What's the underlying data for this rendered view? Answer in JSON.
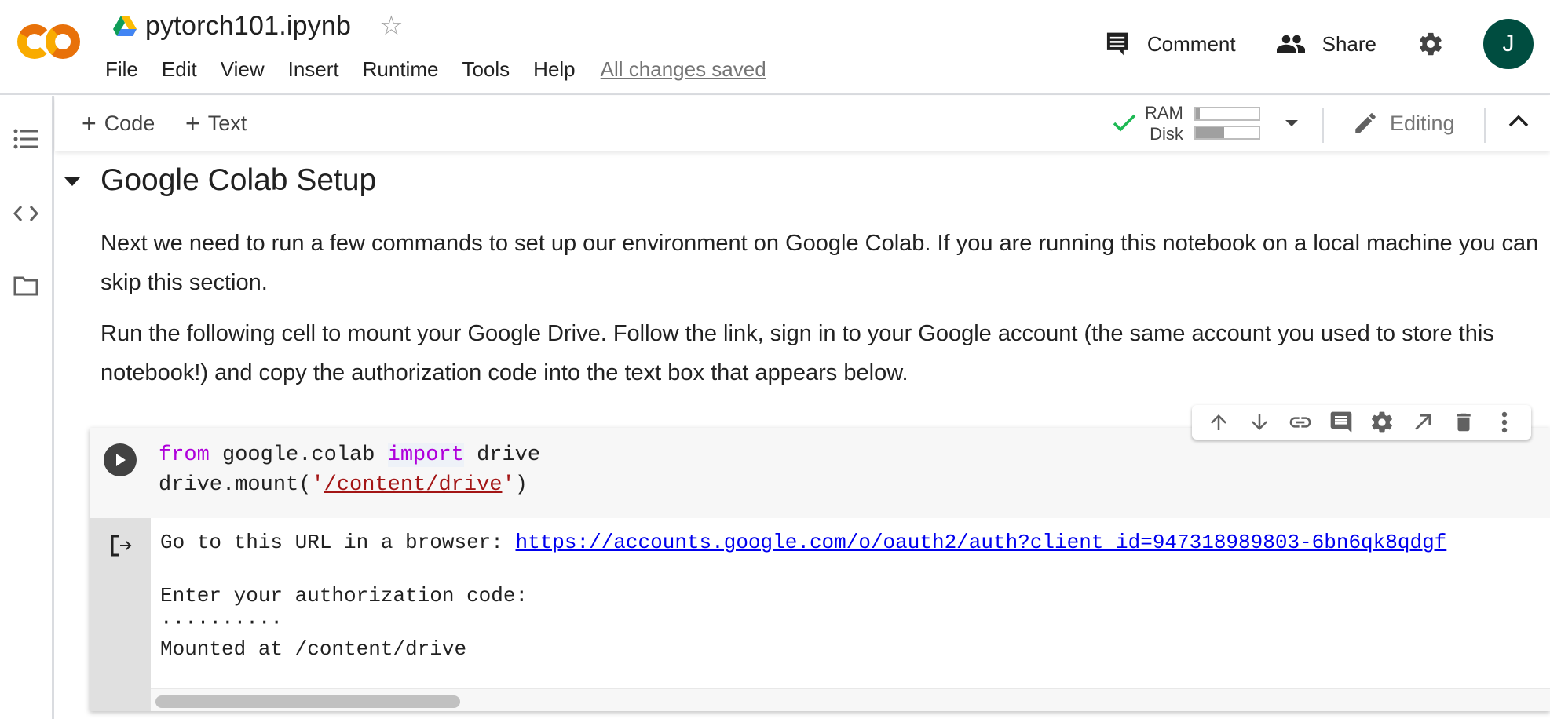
{
  "header": {
    "notebook_title": "pytorch101.ipynb",
    "menu": [
      "File",
      "Edit",
      "View",
      "Insert",
      "Runtime",
      "Tools",
      "Help"
    ],
    "save_status": "All changes saved",
    "comment_label": "Comment",
    "share_label": "Share",
    "avatar_initial": "J",
    "avatar_color": "#004d40",
    "logo_colors": [
      "#f9ab00",
      "#e8710a"
    ]
  },
  "sidebar": {
    "items": [
      {
        "icon": "table-of-contents-icon"
      },
      {
        "icon": "code-snippets-icon"
      },
      {
        "icon": "files-folder-icon"
      }
    ]
  },
  "toolbar": {
    "add_code_label": "Code",
    "add_text_label": "Text",
    "resources": {
      "status": "connected",
      "status_color": "#1db954",
      "ram_label": "RAM",
      "disk_label": "Disk",
      "ram_usage_fraction": 0.06,
      "disk_usage_fraction": 0.45
    },
    "mode_label": "Editing"
  },
  "notebook": {
    "section_heading": "Google Colab Setup",
    "paragraphs": [
      "Next we need to run a few commands to set up our environment on Google Colab. If you are running this notebook on a local machine you can skip this section.",
      "Run the following cell to mount your Google Drive. Follow the link, sign in to your Google account (the same account you used to store this notebook!) and copy the authorization code into the text box that appears below."
    ],
    "cell": {
      "code": {
        "line1": {
          "kw1": "from",
          "mod": " google.colab ",
          "kw2": "import",
          "rest": " drive"
        },
        "line2": {
          "pre": "drive.mount(",
          "q1": "'",
          "path": "/content/drive",
          "q2": "'",
          "post": ")"
        }
      },
      "output": {
        "url_prefix": "Go to this URL in a browser: ",
        "url": "https://accounts.google.com/o/oauth2/auth?client_id=947318989803-6bn6qk8qdgf",
        "prompt": "Enter your authorization code:",
        "masked_input": "··········",
        "result": "Mounted at /content/drive"
      },
      "tools": [
        "move-up-icon",
        "move-down-icon",
        "link-icon",
        "comment-icon",
        "settings-icon",
        "open-in-tab-icon",
        "delete-icon",
        "more-options-icon"
      ]
    }
  }
}
